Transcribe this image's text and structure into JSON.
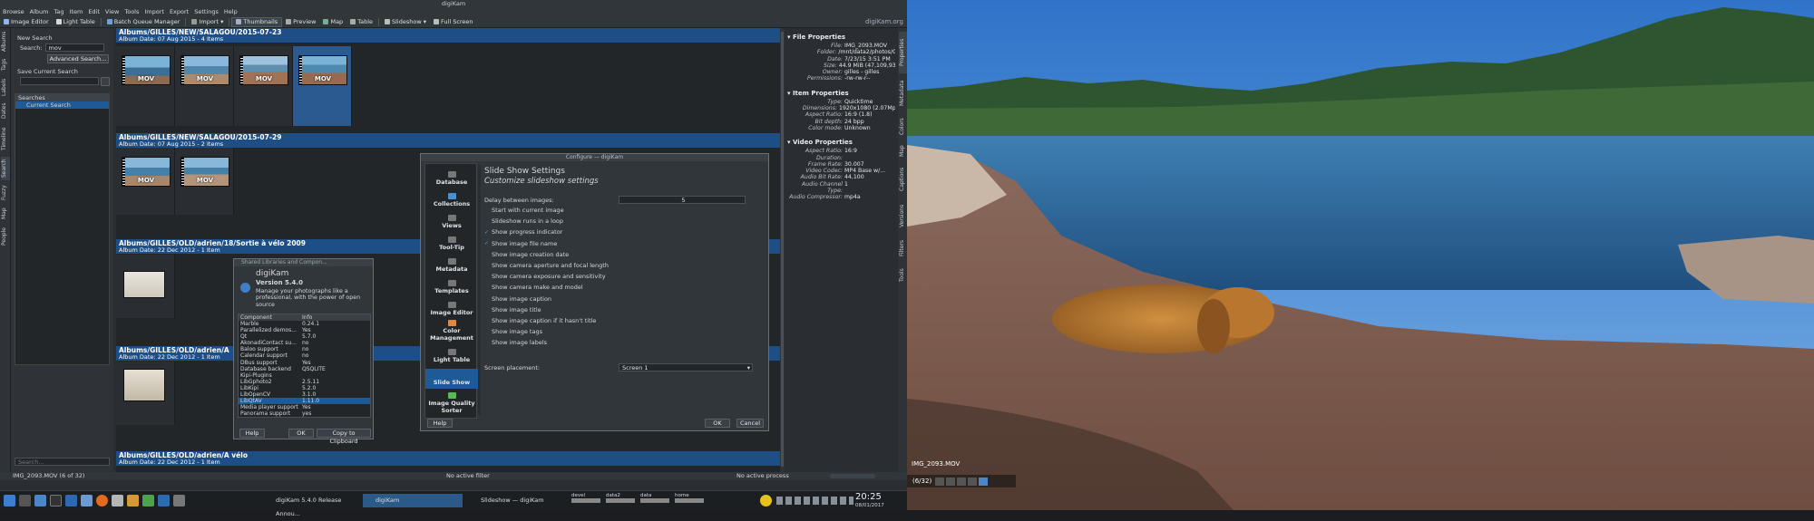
{
  "window_title": "digiKam",
  "menu": [
    "Browse",
    "Album",
    "Tag",
    "Item",
    "Edit",
    "View",
    "Tools",
    "Import",
    "Export",
    "Settings",
    "Help"
  ],
  "toolbar": {
    "image_editor": "Image Editor",
    "light_table": "Light Table",
    "batch_queue": "Batch Queue Manager",
    "import": "Import",
    "thumbnails": "Thumbnails",
    "preview": "Preview",
    "map": "Map",
    "table": "Table",
    "slideshow": "Slideshow",
    "full_screen": "Full Screen",
    "brand": "digiKam.org"
  },
  "left_tabs": [
    "Albums",
    "Tags",
    "Labels",
    "Dates",
    "Timeline",
    "Search",
    "Fuzzy",
    "Map",
    "People"
  ],
  "search_panel": {
    "new_search": "New Search",
    "search_label": "Search:",
    "search_value": "mov",
    "advanced": "Advanced Search...",
    "save_current": "Save Current Search",
    "searches_header": "Searches",
    "current_search": "Current Search",
    "bottom_placeholder": "Search..."
  },
  "albums": [
    {
      "path": "Albums/GILLES/NEW/SALAGOU/2015-07-23",
      "info": "Album Date: 07 Aug 2015 - 4 Items"
    },
    {
      "path": "Albums/GILLES/NEW/SALAGOU/2015-07-29",
      "info": "Album Date: 07 Aug 2015 - 2 Items"
    },
    {
      "path": "Albums/GILLES/OLD/adrien/18/Sortie à vélo 2009",
      "info": "Album Date: 22 Dec 2012 - 1 Item"
    },
    {
      "path": "Albums/GILLES/OLD/adrien/A",
      "info": "Album Date: 22 Dec 2012 - 1 Item"
    },
    {
      "path": "Albums/GILLES/OLD/adrien/A vélo",
      "info": "Album Date: 22 Dec 2012 - 1 Item"
    }
  ],
  "thumb_label": "MOV",
  "properties": {
    "file_header": "File Properties",
    "file": [
      {
        "k": "File:",
        "v": "IMG_2093.MOV"
      },
      {
        "k": "Folder:",
        "v": "/mnt/data2/photos/G..."
      },
      {
        "k": "Date:",
        "v": "7/23/15 3:51 PM"
      },
      {
        "k": "Size:",
        "v": "44.9 MiB (47,109,935)"
      },
      {
        "k": "Owner:",
        "v": "gilles - gilles"
      },
      {
        "k": "Permissions:",
        "v": "-rw-rw-r--"
      }
    ],
    "item_header": "Item Properties",
    "item": [
      {
        "k": "Type:",
        "v": "Quicktime"
      },
      {
        "k": "Dimensions:",
        "v": "1920x1080 (2.07Mpx)"
      },
      {
        "k": "Aspect Ratio:",
        "v": "16:9 (1.8)"
      },
      {
        "k": "Bit depth:",
        "v": "24 bpp"
      },
      {
        "k": "Color mode:",
        "v": "Unknown"
      }
    ],
    "video_header": "Video Properties",
    "video": [
      {
        "k": "Aspect Ratio:",
        "v": "16:9"
      },
      {
        "k": "Duration:",
        "v": ""
      },
      {
        "k": "Frame Rate:",
        "v": "30.007"
      },
      {
        "k": "Video Codec:",
        "v": "MP4 Base w/..."
      },
      {
        "k": "Audio Bit Rate:",
        "v": "44,100"
      },
      {
        "k": "Audio Channel Type:",
        "v": "1"
      },
      {
        "k": "Audio Compressor:",
        "v": "mp4a"
      }
    ]
  },
  "right_tabs": [
    "Properties",
    "Metadata",
    "Colors",
    "Map",
    "Captions",
    "Versions",
    "Filters",
    "Tools"
  ],
  "about_dialog": {
    "title": "Shared Libraries and Compon...",
    "app": "digiKam",
    "version": "Version 5.4.0",
    "desc": "Manage your photographs like a professional, with the power of open source",
    "col_component": "Component",
    "col_info": "Info",
    "rows": [
      {
        "c": "Marble",
        "i": "0.24.1"
      },
      {
        "c": "Parallelized demos...",
        "i": "Yes"
      },
      {
        "c": "Qt",
        "i": "5.7.0"
      },
      {
        "c": "AkonadiContact su...",
        "i": "no"
      },
      {
        "c": "Baloo support",
        "i": "no"
      },
      {
        "c": "Calendar support",
        "i": "no"
      },
      {
        "c": "DBus support",
        "i": "Yes"
      },
      {
        "c": "Database backend",
        "i": "QSQLITE"
      },
      {
        "c": "Kipi-Plugins",
        "i": ""
      },
      {
        "c": "LibGphoto2",
        "i": "2.5.11"
      },
      {
        "c": "LibKipi",
        "i": "5.2.0"
      },
      {
        "c": "LibOpenCV",
        "i": "3.1.0"
      },
      {
        "c": "LibQtAV",
        "i": "1.11.0"
      },
      {
        "c": "Media player support",
        "i": "Yes"
      },
      {
        "c": "Panorama support",
        "i": "yes"
      }
    ],
    "help": "Help",
    "ok": "OK",
    "copy": "Copy to Clipboard"
  },
  "config_dialog": {
    "title": "Configure — digiKam",
    "sidebar": [
      "Database",
      "Collections",
      "Views",
      "Tool-Tip",
      "Metadata",
      "Templates",
      "Image Editor",
      "Color Management",
      "Light Table",
      "Slide Show",
      "Image Quality Sorter"
    ],
    "heading": "Slide Show Settings",
    "subheading": "Customize slideshow settings",
    "delay_label": "Delay between images:",
    "delay_value": "5",
    "options": [
      {
        "label": "Start with current image",
        "checked": false
      },
      {
        "label": "Slideshow runs in a loop",
        "checked": false
      },
      {
        "label": "Show progress indicator",
        "checked": true
      },
      {
        "label": "Show image file name",
        "checked": true
      },
      {
        "label": "Show image creation date",
        "checked": false
      },
      {
        "label": "Show camera aperture and focal length",
        "checked": false
      },
      {
        "label": "Show camera exposure and sensitivity",
        "checked": false
      },
      {
        "label": "Show camera make and model",
        "checked": false
      },
      {
        "label": "Show image caption",
        "checked": false
      },
      {
        "label": "Show image title",
        "checked": false
      },
      {
        "label": "Show image caption if it hasn't title",
        "checked": false
      },
      {
        "label": "Show image tags",
        "checked": false
      },
      {
        "label": "Show image labels",
        "checked": false
      }
    ],
    "placement_label": "Screen placement:",
    "placement_value": "Screen 1",
    "help": "Help",
    "ok": "OK",
    "cancel": "Cancel"
  },
  "statusbar": {
    "left": "IMG_2093.MOV (6 of 32)",
    "filter": "No active filter",
    "process": "No active process"
  },
  "taskbar": {
    "task1": "digiKam 5.4.0 Release Annou...",
    "task2": "digiKam",
    "task3": "Slideshow — digiKam",
    "meters": [
      "devel",
      "data2",
      "data",
      "home"
    ],
    "time": "20:25",
    "date": "08/01/2017"
  },
  "slideshow": {
    "filename": "IMG_2093.MOV",
    "counter": "(6/32)"
  },
  "colors": {
    "accent": "#1d4f86",
    "selection": "#1e5a96"
  }
}
